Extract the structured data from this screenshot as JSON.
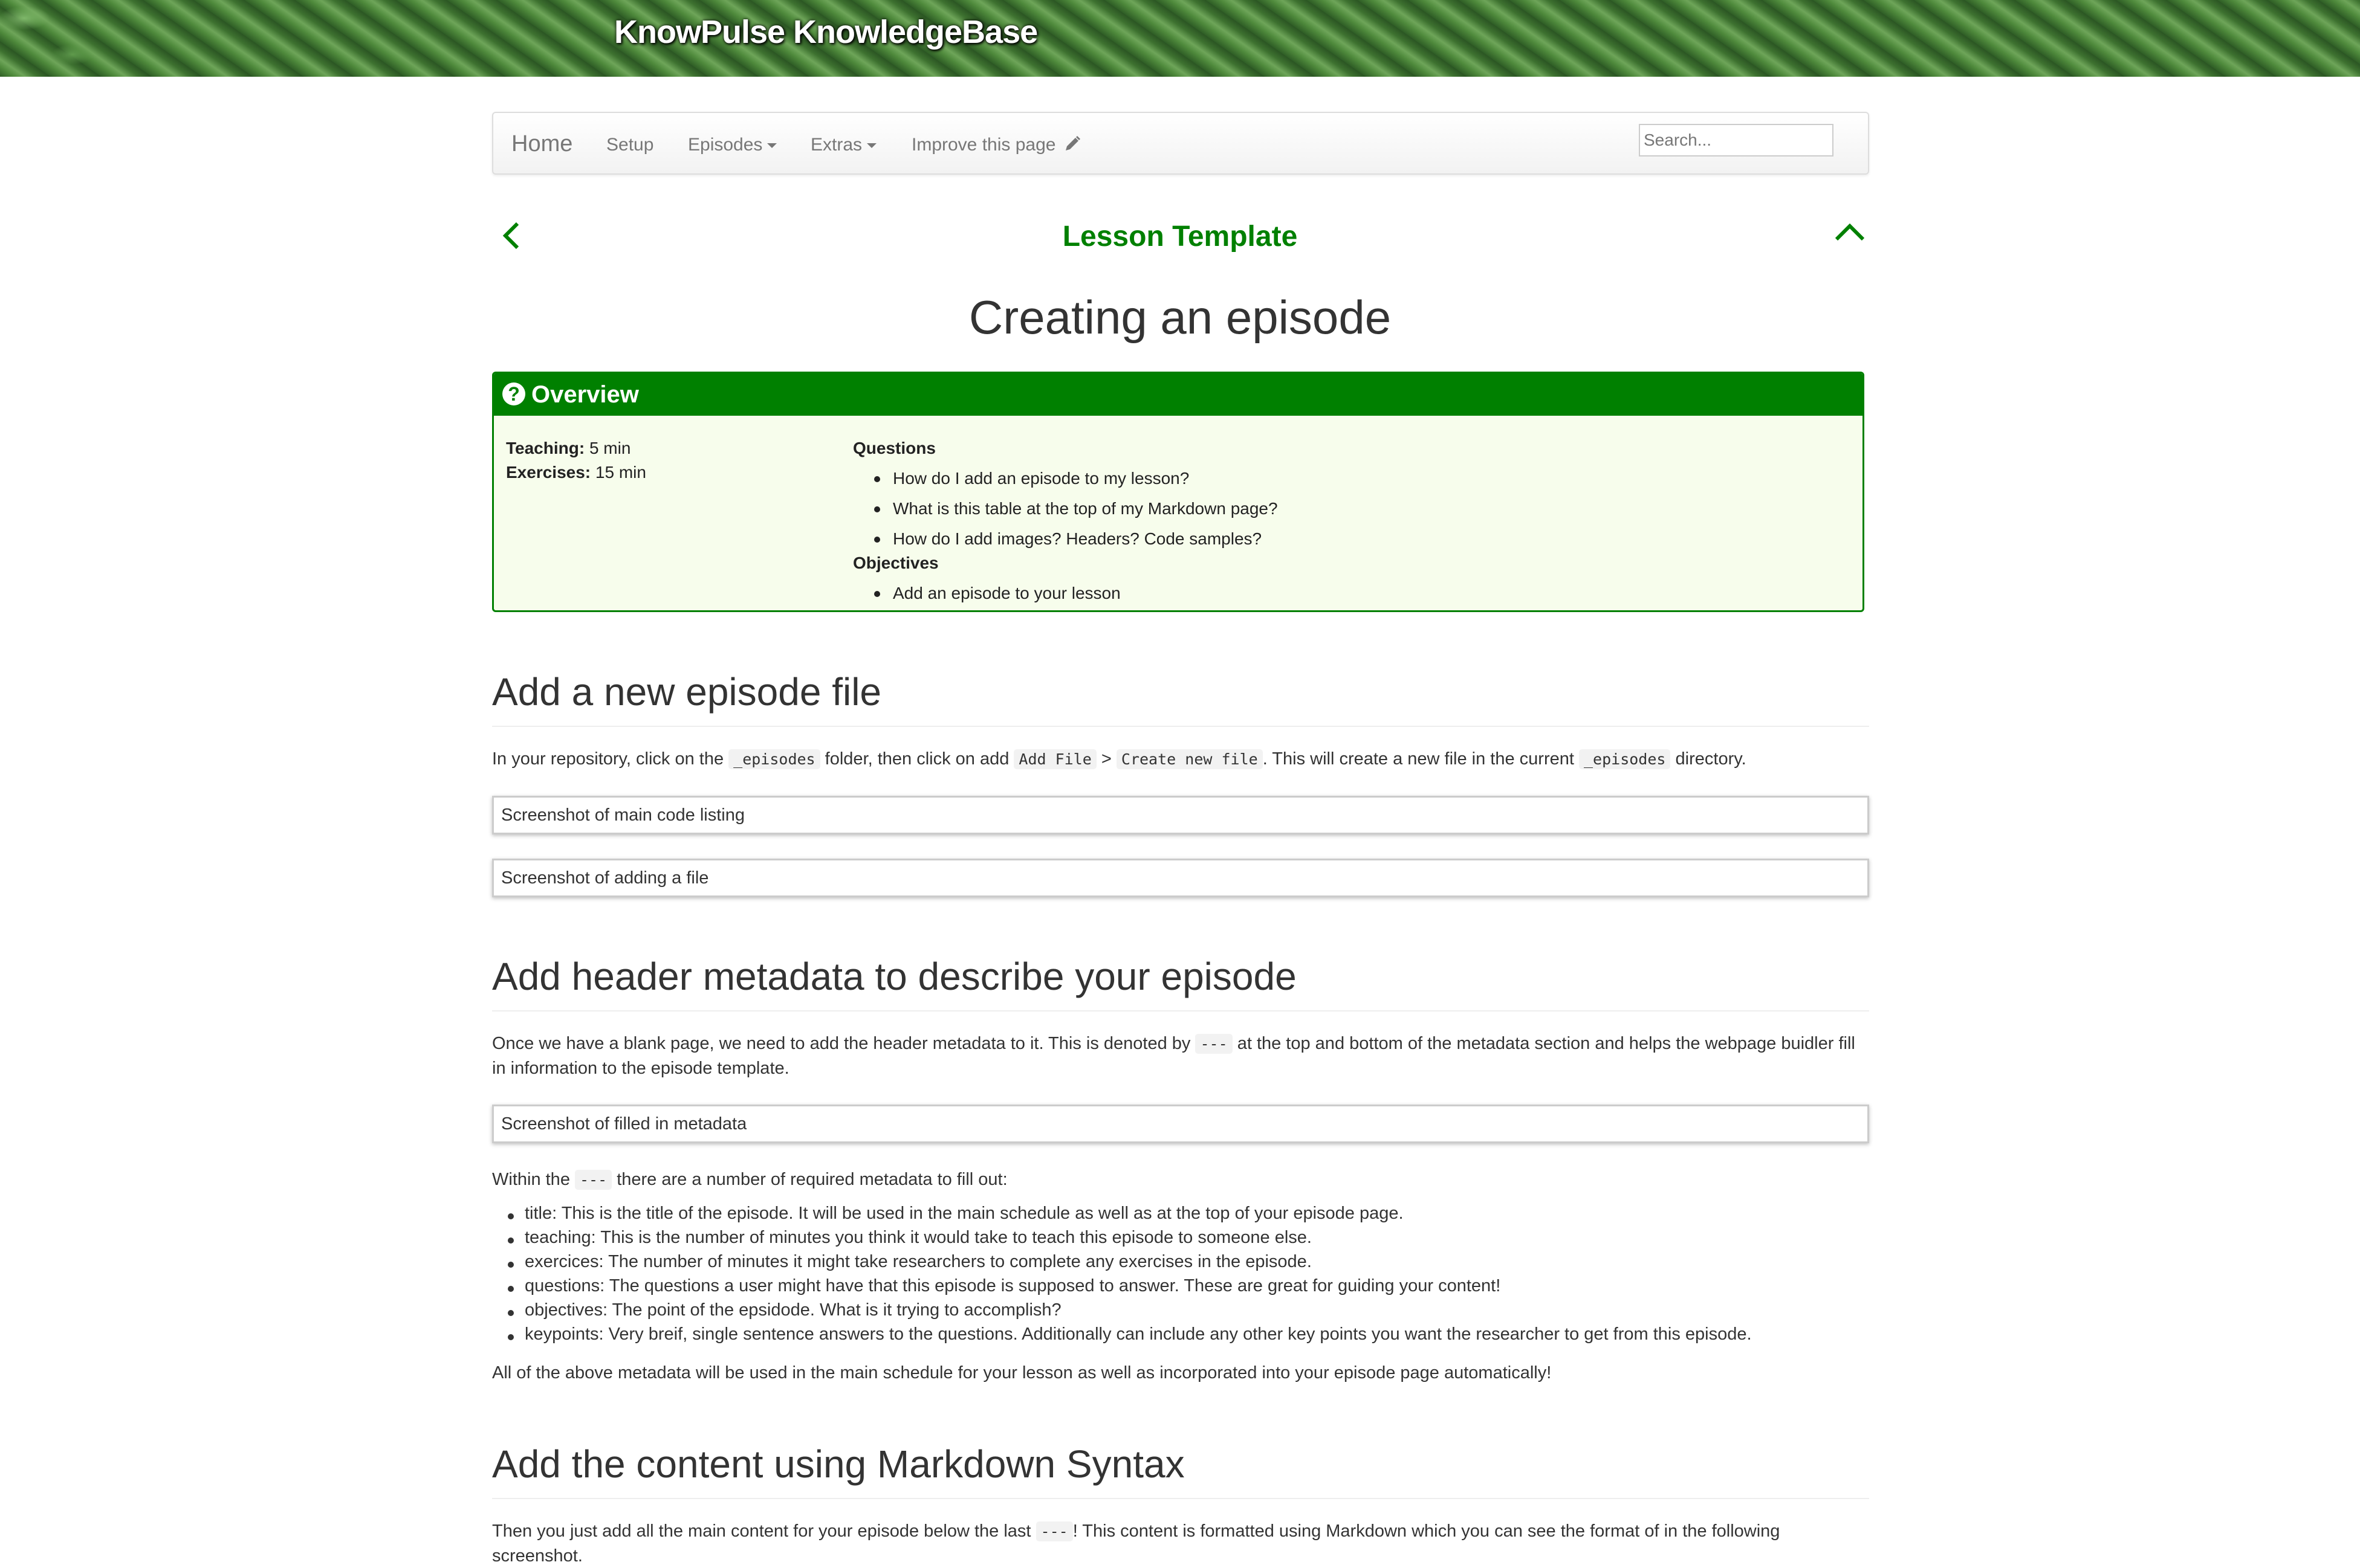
{
  "banner": {
    "title": "KnowPulse KnowledgeBase"
  },
  "navbar": {
    "home": "Home",
    "setup": "Setup",
    "episodes": "Episodes",
    "extras": "Extras",
    "improve": "Improve this page",
    "search_placeholder": "Search..."
  },
  "lesson": {
    "title": "Lesson Template"
  },
  "page": {
    "title": "Creating an episode"
  },
  "overview": {
    "heading": "Overview",
    "teaching_label": "Teaching:",
    "teaching_value": "5 min",
    "exercises_label": "Exercises:",
    "exercises_value": "15 min",
    "questions_label": "Questions",
    "questions": [
      "How do I add an episode to my lesson?",
      "What is this table at the top of my Markdown page?",
      "How do I add images? Headers? Code samples?"
    ],
    "objectives_label": "Objectives",
    "objectives": [
      "Add an episode to your lesson"
    ]
  },
  "section1": {
    "heading": "Add a new episode file",
    "p1_a": "In your repository, click on the ",
    "p1_code1": "_episodes",
    "p1_b": " folder, then click on add ",
    "p1_code2": "Add File",
    "p1_c": " > ",
    "p1_code3": "Create new file",
    "p1_d": ". This will create a new file in the current ",
    "p1_code4": "_episodes",
    "p1_e": " directory.",
    "shot1": "Screenshot of main code listing",
    "shot2": "Screenshot of adding a file"
  },
  "section2": {
    "heading": "Add header metadata to describe your episode",
    "p1_a": "Once we have a blank page, we need to add the header metadata to it. This is denoted by ",
    "p1_code": "---",
    "p1_b": " at the top and bottom of the metadata section and helps the webpage buidler fill in information to the episode template.",
    "shot": "Screenshot of filled in metadata",
    "p2_a": "Within the ",
    "p2_code": "---",
    "p2_b": " there are a number of required metadata to fill out:",
    "items": [
      "title: This is the title of the episode. It will be used in the main schedule as well as at the top of your episode page.",
      "teaching: This is the number of minutes you think it would take to teach this episode to someone else.",
      "exercices: The number of minutes it might take researchers to complete any exercises in the episode.",
      "questions: The questions a user might have that this episode is supposed to answer. These are great for guiding your content!",
      "objectives: The point of the epsidode. What is it trying to accomplish?",
      "keypoints: Very breif, single sentence answers to the questions. Additionally can include any other key points you want the researcher to get from this episode."
    ],
    "p3": "All of the above metadata will be used in the main schedule for your lesson as well as incorporated into your episode page automatically!"
  },
  "section3": {
    "heading": "Add the content using Markdown Syntax",
    "p1_a": "Then you just add all the main content for your episode below the last ",
    "p1_code": "---",
    "p1_b": "! This content is formatted using Markdown which you can see the format of in the following screenshot."
  },
  "colors": {
    "accent": "#008000",
    "overview_bg": "#f7fdec",
    "text": "#333333"
  },
  "icons": {
    "prev": "chevron-left-icon",
    "up": "chevron-up-icon",
    "edit": "pencil-icon",
    "overview": "question-circle-icon"
  }
}
